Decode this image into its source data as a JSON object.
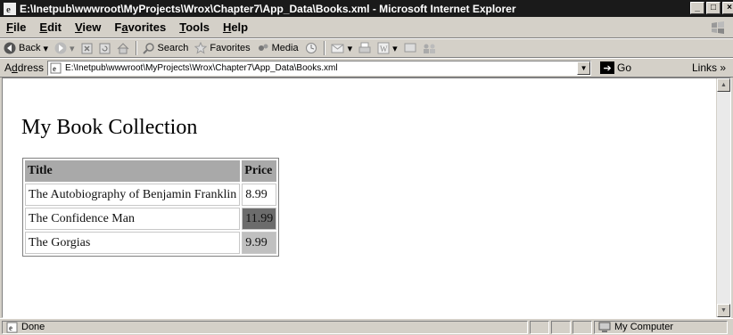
{
  "window": {
    "title": "E:\\Inetpub\\wwwroot\\MyProjects\\Wrox\\Chapter7\\App_Data\\Books.xml - Microsoft Internet Explorer",
    "min_glyph": "_",
    "max_glyph": "□",
    "close_glyph": "×"
  },
  "menu": {
    "items": [
      {
        "label": "File",
        "hotkey": "F",
        "rest": "ile"
      },
      {
        "label": "Edit",
        "hotkey": "E",
        "rest": "dit"
      },
      {
        "label": "View",
        "hotkey": "V",
        "rest": "iew"
      },
      {
        "label": "Favorites",
        "hotkey": "a",
        "pre": "F",
        "rest": "vorites"
      },
      {
        "label": "Tools",
        "hotkey": "T",
        "rest": "ools"
      },
      {
        "label": "Help",
        "hotkey": "H",
        "rest": "elp"
      }
    ]
  },
  "toolbar": {
    "back": "Back",
    "search": "Search",
    "favorites": "Favorites",
    "media": "Media"
  },
  "address": {
    "label": "Address",
    "hotkey": "d",
    "url": "E:\\Inetpub\\wwwroot\\MyProjects\\Wrox\\Chapter7\\App_Data\\Books.xml",
    "go": "Go",
    "links": "Links »"
  },
  "page": {
    "heading": "My Book Collection",
    "table": {
      "headers": [
        "Title",
        "Price"
      ],
      "rows": [
        {
          "title": "The Autobiography of Benjamin Franklin",
          "price": "8.99"
        },
        {
          "title": "The Confidence Man",
          "price": "11.99"
        },
        {
          "title": "The Gorgias",
          "price": "9.99"
        }
      ]
    }
  },
  "status": {
    "text": "Done",
    "zone": "My Computer"
  },
  "colors": {
    "title_bar": "#1a1a1a",
    "chrome": "#d4d0c8",
    "header_cell": "#a9a9a9",
    "price_high": "#6c6c6c",
    "price_mid": "#c0c0c0"
  }
}
